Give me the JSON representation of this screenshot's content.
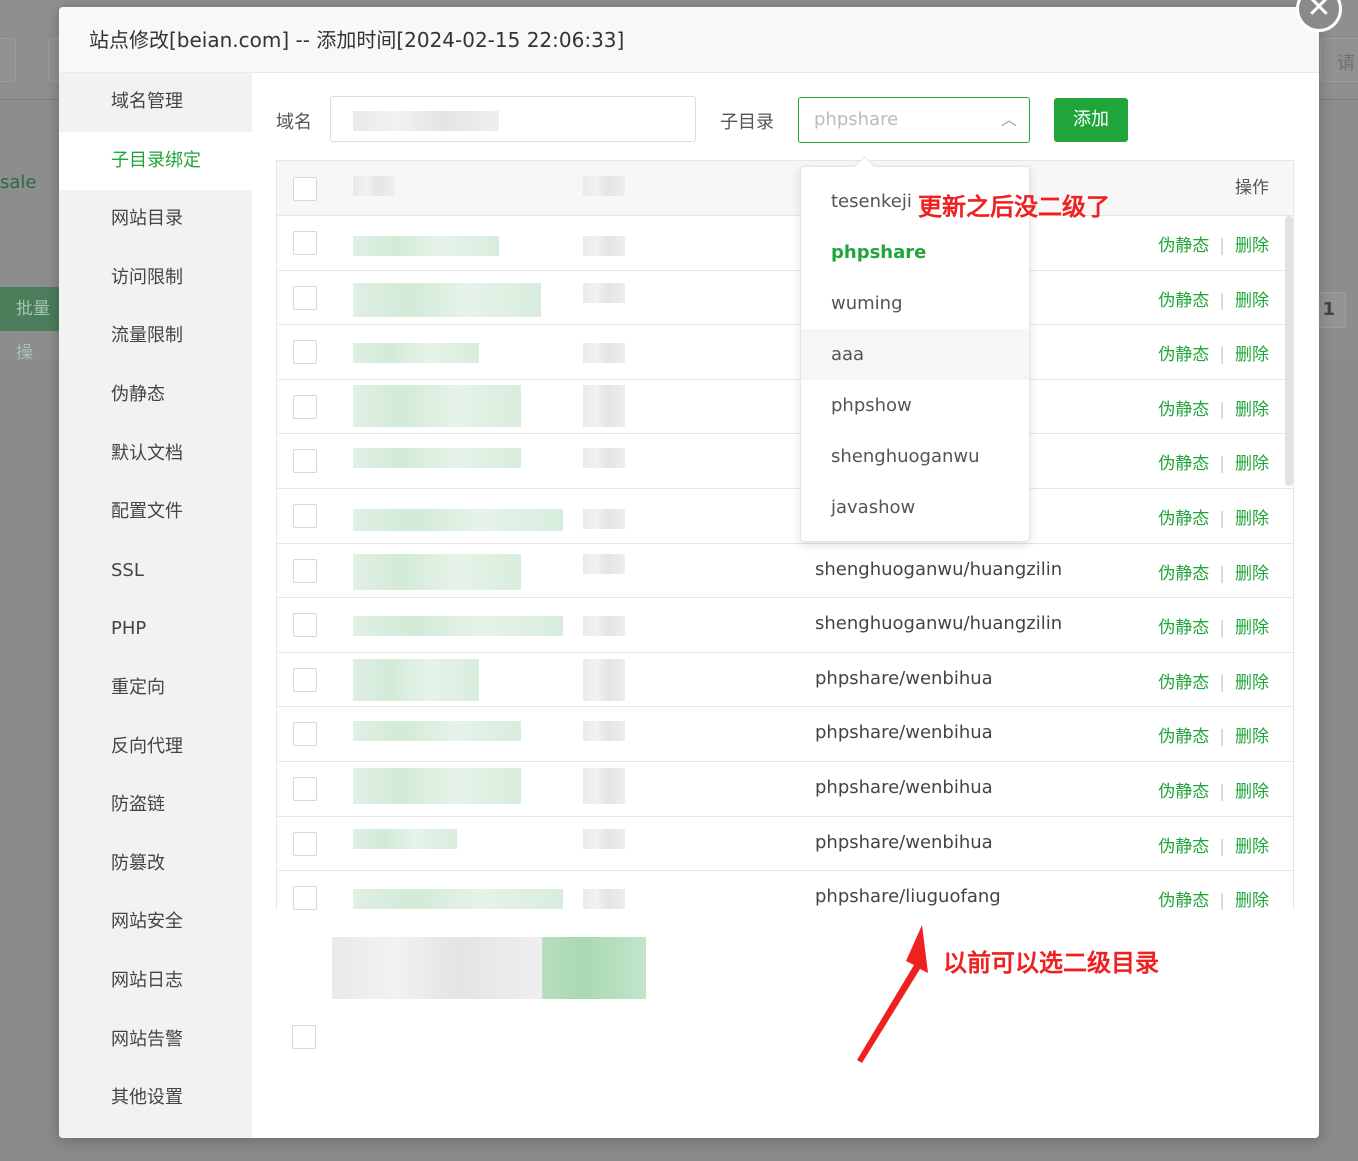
{
  "background": {
    "left_text": "sale",
    "batch_button": "批量操",
    "page_number": "1",
    "right_text": "请"
  },
  "dialog": {
    "title": "站点修改[beian.com] -- 添加时间[2024-02-15 22:06:33]",
    "close_icon": "close-icon"
  },
  "sidebar": {
    "items": [
      {
        "label": "域名管理"
      },
      {
        "label": "子目录绑定"
      },
      {
        "label": "网站目录"
      },
      {
        "label": "访问限制"
      },
      {
        "label": "流量限制"
      },
      {
        "label": "伪静态"
      },
      {
        "label": "默认文档"
      },
      {
        "label": "配置文件"
      },
      {
        "label": "SSL"
      },
      {
        "label": "PHP"
      },
      {
        "label": "重定向"
      },
      {
        "label": "反向代理"
      },
      {
        "label": "防盗链"
      },
      {
        "label": "防篡改"
      },
      {
        "label": "网站安全"
      },
      {
        "label": "网站日志"
      },
      {
        "label": "网站告警"
      },
      {
        "label": "其他设置"
      }
    ],
    "active_index": 1
  },
  "form": {
    "domain_label": "域名",
    "subdir_label": "子目录",
    "subdir_value": "phpshare",
    "add_button": "添加"
  },
  "table": {
    "op_header": "操作",
    "rows": [
      {
        "subdir": ""
      },
      {
        "subdir": ""
      },
      {
        "subdir": ""
      },
      {
        "subdir": ""
      },
      {
        "subdir": ""
      },
      {
        "subdir": ""
      },
      {
        "subdir": "shenghuoganwu/huangzilin"
      },
      {
        "subdir": "shenghuoganwu/huangzilin"
      },
      {
        "subdir": "phpshare/wenbihua"
      },
      {
        "subdir": "phpshare/wenbihua"
      },
      {
        "subdir": "phpshare/wenbihua"
      },
      {
        "subdir": "phpshare/wenbihua"
      },
      {
        "subdir": "phpshare/liuguofang"
      }
    ],
    "op_rewrite": "伪静态",
    "op_delete": "删除"
  },
  "dropdown": {
    "options": [
      "tesenkeji",
      "phpshare",
      "wuming",
      "aaa",
      "phpshow",
      "shenghuoganwu",
      "javashow"
    ],
    "selected": "phpshare",
    "hovered": "aaa"
  },
  "annotations": {
    "top": "更新之后没二级了",
    "bottom": "以前可以选二级目录"
  },
  "colors": {
    "accent": "#20a53a",
    "annotation": "#f02020"
  }
}
